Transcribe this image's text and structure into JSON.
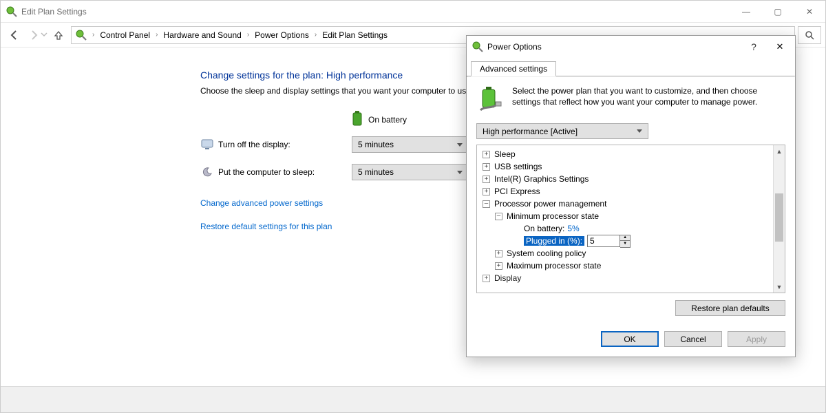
{
  "titlebar": {
    "title": "Edit Plan Settings"
  },
  "win_controls": {
    "min": "—",
    "max": "▢",
    "close": "✕"
  },
  "nav": {
    "breadcrumbs": [
      "Control Panel",
      "Hardware and Sound",
      "Power Options",
      "Edit Plan Settings"
    ]
  },
  "main": {
    "heading": "Change settings for the plan: High performance",
    "subhead": "Choose the sleep and display settings that you want your computer to use.",
    "col_battery": "On battery",
    "row_display": {
      "label": "Turn off the display:",
      "value": "5 minutes"
    },
    "row_sleep": {
      "label": "Put the computer to sleep:",
      "value": "5 minutes"
    },
    "link_advanced": "Change advanced power settings",
    "link_restore": "Restore default settings for this plan"
  },
  "dialog": {
    "title": "Power Options",
    "help": "?",
    "close": "✕",
    "tab": "Advanced settings",
    "intro": "Select the power plan that you want to customize, and then choose settings that reflect how you want your computer to manage power.",
    "plan_selected": "High performance [Active]",
    "tree": {
      "sleep": "Sleep",
      "usb": "USB settings",
      "intel": "Intel(R) Graphics Settings",
      "pci": "PCI Express",
      "ppm": "Processor power management",
      "min_state": "Minimum processor state",
      "on_battery_label": "On battery:",
      "on_battery_value": "5%",
      "plugged_label": "Plugged in (%):",
      "plugged_value": "5",
      "cooling": "System cooling policy",
      "max_state": "Maximum processor state",
      "display": "Display"
    },
    "restore_defaults": "Restore plan defaults",
    "btn_ok": "OK",
    "btn_cancel": "Cancel",
    "btn_apply": "Apply"
  }
}
